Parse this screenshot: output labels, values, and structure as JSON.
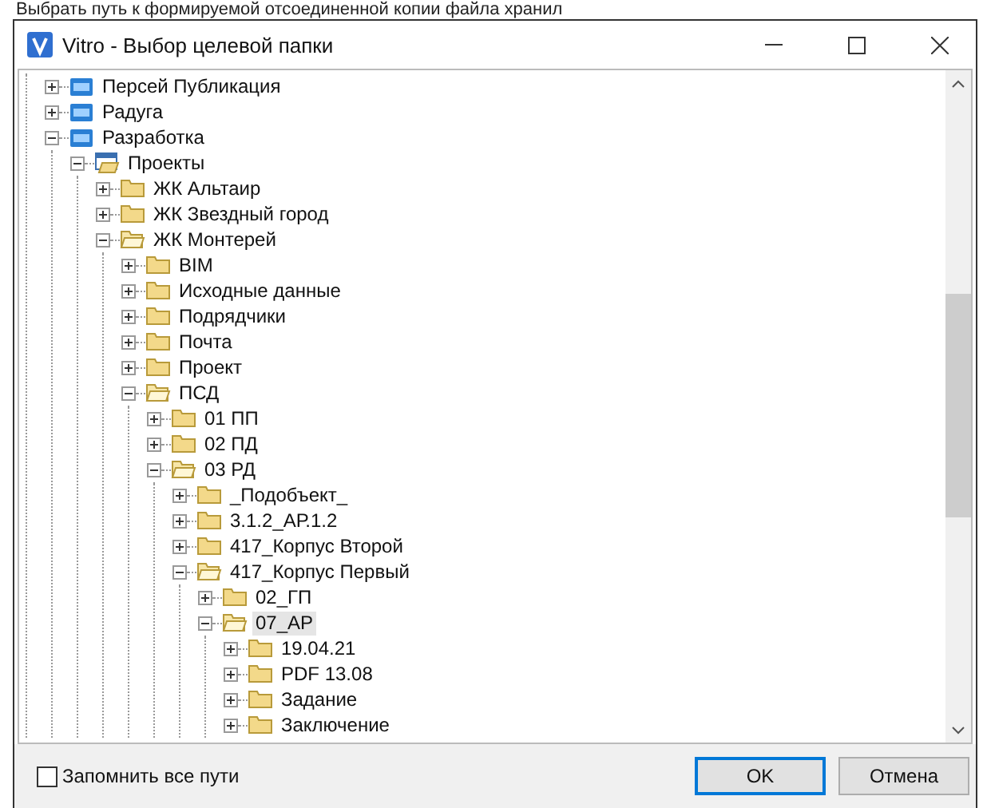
{
  "background_text": "Выбрать путь к формируемой отсоединенной копии файла хранил",
  "window": {
    "title": "Vitro - Выбор целевой папки"
  },
  "tree": [
    {
      "label": "Персей Публикация",
      "kind": "store",
      "expanded": false,
      "selected": false
    },
    {
      "label": "Радуга",
      "kind": "store",
      "expanded": false,
      "selected": false
    },
    {
      "label": "Разработка",
      "kind": "store",
      "expanded": true,
      "selected": false,
      "children": [
        {
          "label": "Проекты",
          "kind": "project",
          "expanded": true,
          "selected": false,
          "children": [
            {
              "label": "ЖК Альтаир",
              "kind": "folder",
              "expanded": false,
              "selected": false
            },
            {
              "label": "ЖК Звездный город",
              "kind": "folder",
              "expanded": false,
              "selected": false
            },
            {
              "label": "ЖК Монтерей",
              "kind": "folder",
              "expanded": true,
              "selected": false,
              "children": [
                {
                  "label": "BIM",
                  "kind": "folder",
                  "expanded": false,
                  "selected": false
                },
                {
                  "label": "Исходные данные",
                  "kind": "folder",
                  "expanded": false,
                  "selected": false
                },
                {
                  "label": "Подрядчики",
                  "kind": "folder",
                  "expanded": false,
                  "selected": false
                },
                {
                  "label": "Почта",
                  "kind": "folder",
                  "expanded": false,
                  "selected": false
                },
                {
                  "label": "Проект",
                  "kind": "folder",
                  "expanded": false,
                  "selected": false
                },
                {
                  "label": "ПСД",
                  "kind": "folder",
                  "expanded": true,
                  "selected": false,
                  "children": [
                    {
                      "label": "01 ПП",
                      "kind": "folder",
                      "expanded": false,
                      "selected": false
                    },
                    {
                      "label": "02 ПД",
                      "kind": "folder",
                      "expanded": false,
                      "selected": false
                    },
                    {
                      "label": "03 РД",
                      "kind": "folder",
                      "expanded": true,
                      "selected": false,
                      "children": [
                        {
                          "label": "_Подобъект_",
                          "kind": "folder",
                          "expanded": false,
                          "selected": false
                        },
                        {
                          "label": "3.1.2_АР.1.2",
                          "kind": "folder",
                          "expanded": false,
                          "selected": false
                        },
                        {
                          "label": "417_Корпус Второй",
                          "kind": "folder",
                          "expanded": false,
                          "selected": false
                        },
                        {
                          "label": "417_Корпус Первый",
                          "kind": "folder",
                          "expanded": true,
                          "selected": false,
                          "children": [
                            {
                              "label": "02_ГП",
                              "kind": "folder",
                              "expanded": false,
                              "selected": false
                            },
                            {
                              "label": "07_АР",
                              "kind": "folder",
                              "expanded": true,
                              "selected": true,
                              "children": [
                                {
                                  "label": "19.04.21",
                                  "kind": "folder",
                                  "expanded": false,
                                  "selected": false
                                },
                                {
                                  "label": "PDF 13.08",
                                  "kind": "folder",
                                  "expanded": false,
                                  "selected": false
                                },
                                {
                                  "label": "Задание",
                                  "kind": "folder",
                                  "expanded": false,
                                  "selected": false
                                },
                                {
                                  "label": "Заключение",
                                  "kind": "folder",
                                  "expanded": false,
                                  "selected": false
                                }
                              ]
                            }
                          ]
                        }
                      ]
                    }
                  ]
                }
              ]
            }
          ]
        }
      ]
    }
  ],
  "remember_all_paths": {
    "label": "Запомнить все пути",
    "checked": false
  },
  "buttons": [
    {
      "label": "OK",
      "default": true
    },
    {
      "label": "Отмена",
      "default": false
    }
  ]
}
